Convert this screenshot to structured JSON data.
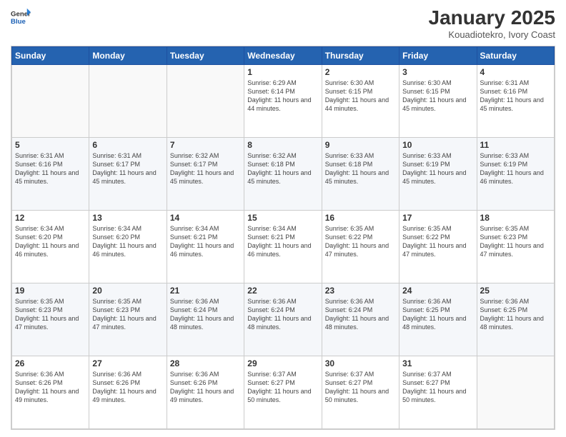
{
  "logo": {
    "general": "General",
    "blue": "Blue"
  },
  "header": {
    "month_year": "January 2025",
    "location": "Kouadiotekro, Ivory Coast"
  },
  "weekdays": [
    "Sunday",
    "Monday",
    "Tuesday",
    "Wednesday",
    "Thursday",
    "Friday",
    "Saturday"
  ],
  "weeks": [
    [
      {
        "day": "",
        "sunrise": "",
        "sunset": "",
        "daylight": "",
        "empty": true
      },
      {
        "day": "",
        "sunrise": "",
        "sunset": "",
        "daylight": "",
        "empty": true
      },
      {
        "day": "",
        "sunrise": "",
        "sunset": "",
        "daylight": "",
        "empty": true
      },
      {
        "day": "1",
        "sunrise": "Sunrise: 6:29 AM",
        "sunset": "Sunset: 6:14 PM",
        "daylight": "Daylight: 11 hours and 44 minutes."
      },
      {
        "day": "2",
        "sunrise": "Sunrise: 6:30 AM",
        "sunset": "Sunset: 6:15 PM",
        "daylight": "Daylight: 11 hours and 44 minutes."
      },
      {
        "day": "3",
        "sunrise": "Sunrise: 6:30 AM",
        "sunset": "Sunset: 6:15 PM",
        "daylight": "Daylight: 11 hours and 45 minutes."
      },
      {
        "day": "4",
        "sunrise": "Sunrise: 6:31 AM",
        "sunset": "Sunset: 6:16 PM",
        "daylight": "Daylight: 11 hours and 45 minutes."
      }
    ],
    [
      {
        "day": "5",
        "sunrise": "Sunrise: 6:31 AM",
        "sunset": "Sunset: 6:16 PM",
        "daylight": "Daylight: 11 hours and 45 minutes."
      },
      {
        "day": "6",
        "sunrise": "Sunrise: 6:31 AM",
        "sunset": "Sunset: 6:17 PM",
        "daylight": "Daylight: 11 hours and 45 minutes."
      },
      {
        "day": "7",
        "sunrise": "Sunrise: 6:32 AM",
        "sunset": "Sunset: 6:17 PM",
        "daylight": "Daylight: 11 hours and 45 minutes."
      },
      {
        "day": "8",
        "sunrise": "Sunrise: 6:32 AM",
        "sunset": "Sunset: 6:18 PM",
        "daylight": "Daylight: 11 hours and 45 minutes."
      },
      {
        "day": "9",
        "sunrise": "Sunrise: 6:33 AM",
        "sunset": "Sunset: 6:18 PM",
        "daylight": "Daylight: 11 hours and 45 minutes."
      },
      {
        "day": "10",
        "sunrise": "Sunrise: 6:33 AM",
        "sunset": "Sunset: 6:19 PM",
        "daylight": "Daylight: 11 hours and 45 minutes."
      },
      {
        "day": "11",
        "sunrise": "Sunrise: 6:33 AM",
        "sunset": "Sunset: 6:19 PM",
        "daylight": "Daylight: 11 hours and 46 minutes."
      }
    ],
    [
      {
        "day": "12",
        "sunrise": "Sunrise: 6:34 AM",
        "sunset": "Sunset: 6:20 PM",
        "daylight": "Daylight: 11 hours and 46 minutes."
      },
      {
        "day": "13",
        "sunrise": "Sunrise: 6:34 AM",
        "sunset": "Sunset: 6:20 PM",
        "daylight": "Daylight: 11 hours and 46 minutes."
      },
      {
        "day": "14",
        "sunrise": "Sunrise: 6:34 AM",
        "sunset": "Sunset: 6:21 PM",
        "daylight": "Daylight: 11 hours and 46 minutes."
      },
      {
        "day": "15",
        "sunrise": "Sunrise: 6:34 AM",
        "sunset": "Sunset: 6:21 PM",
        "daylight": "Daylight: 11 hours and 46 minutes."
      },
      {
        "day": "16",
        "sunrise": "Sunrise: 6:35 AM",
        "sunset": "Sunset: 6:22 PM",
        "daylight": "Daylight: 11 hours and 47 minutes."
      },
      {
        "day": "17",
        "sunrise": "Sunrise: 6:35 AM",
        "sunset": "Sunset: 6:22 PM",
        "daylight": "Daylight: 11 hours and 47 minutes."
      },
      {
        "day": "18",
        "sunrise": "Sunrise: 6:35 AM",
        "sunset": "Sunset: 6:23 PM",
        "daylight": "Daylight: 11 hours and 47 minutes."
      }
    ],
    [
      {
        "day": "19",
        "sunrise": "Sunrise: 6:35 AM",
        "sunset": "Sunset: 6:23 PM",
        "daylight": "Daylight: 11 hours and 47 minutes."
      },
      {
        "day": "20",
        "sunrise": "Sunrise: 6:35 AM",
        "sunset": "Sunset: 6:23 PM",
        "daylight": "Daylight: 11 hours and 47 minutes."
      },
      {
        "day": "21",
        "sunrise": "Sunrise: 6:36 AM",
        "sunset": "Sunset: 6:24 PM",
        "daylight": "Daylight: 11 hours and 48 minutes."
      },
      {
        "day": "22",
        "sunrise": "Sunrise: 6:36 AM",
        "sunset": "Sunset: 6:24 PM",
        "daylight": "Daylight: 11 hours and 48 minutes."
      },
      {
        "day": "23",
        "sunrise": "Sunrise: 6:36 AM",
        "sunset": "Sunset: 6:24 PM",
        "daylight": "Daylight: 11 hours and 48 minutes."
      },
      {
        "day": "24",
        "sunrise": "Sunrise: 6:36 AM",
        "sunset": "Sunset: 6:25 PM",
        "daylight": "Daylight: 11 hours and 48 minutes."
      },
      {
        "day": "25",
        "sunrise": "Sunrise: 6:36 AM",
        "sunset": "Sunset: 6:25 PM",
        "daylight": "Daylight: 11 hours and 48 minutes."
      }
    ],
    [
      {
        "day": "26",
        "sunrise": "Sunrise: 6:36 AM",
        "sunset": "Sunset: 6:26 PM",
        "daylight": "Daylight: 11 hours and 49 minutes."
      },
      {
        "day": "27",
        "sunrise": "Sunrise: 6:36 AM",
        "sunset": "Sunset: 6:26 PM",
        "daylight": "Daylight: 11 hours and 49 minutes."
      },
      {
        "day": "28",
        "sunrise": "Sunrise: 6:36 AM",
        "sunset": "Sunset: 6:26 PM",
        "daylight": "Daylight: 11 hours and 49 minutes."
      },
      {
        "day": "29",
        "sunrise": "Sunrise: 6:37 AM",
        "sunset": "Sunset: 6:27 PM",
        "daylight": "Daylight: 11 hours and 50 minutes."
      },
      {
        "day": "30",
        "sunrise": "Sunrise: 6:37 AM",
        "sunset": "Sunset: 6:27 PM",
        "daylight": "Daylight: 11 hours and 50 minutes."
      },
      {
        "day": "31",
        "sunrise": "Sunrise: 6:37 AM",
        "sunset": "Sunset: 6:27 PM",
        "daylight": "Daylight: 11 hours and 50 minutes."
      },
      {
        "day": "",
        "sunrise": "",
        "sunset": "",
        "daylight": "",
        "empty": true
      }
    ]
  ]
}
